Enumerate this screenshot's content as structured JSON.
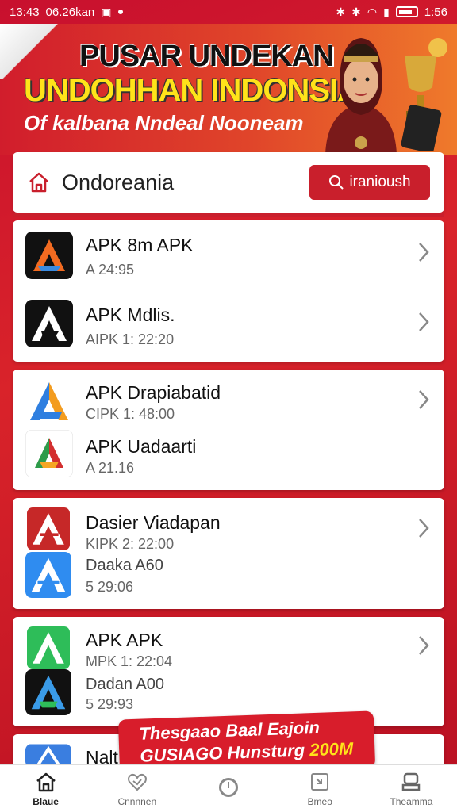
{
  "status_bar": {
    "time": "13:43",
    "carrier": "06.26kan",
    "clock_right": "1:56"
  },
  "banner": {
    "title1": "PUSAR UNDEKAN",
    "title2": "UNDOHHAN INDONSIA",
    "subtitle": "Of kalbana Nndeal Nooneam"
  },
  "search": {
    "title": "Ondoreania",
    "button_label": "iranioush",
    "icon": "home-icon"
  },
  "cards": [
    {
      "items": [
        {
          "title": "APK 8m APK",
          "sub": "A 24:95",
          "icon": "orange-a-icon"
        },
        {
          "title": "APK Mdlis.",
          "sub": "AIPK 1: 22:20",
          "icon": "black-a-icon"
        }
      ]
    },
    {
      "items": [
        {
          "title": "APK Drapiabatid",
          "sub": "CIPK 1: 48:00",
          "icon": "multicolor-a-icon"
        },
        {
          "title": "APK Uadaarti",
          "sub": "A 21.16",
          "icon": "tri-color-a-icon"
        }
      ]
    },
    {
      "items": [
        {
          "title": "Dasier Viadapan",
          "sub": "KIPK 2: 22:00",
          "icon": "red-a-icon"
        },
        {
          "title": "Daaka A60",
          "sub": "5 29:06",
          "icon": "blue-a-icon"
        }
      ]
    },
    {
      "items": [
        {
          "title": "APK APK",
          "sub": "MPK 1: 22:04",
          "icon": "green-a-icon"
        },
        {
          "title": "Dadan A00",
          "sub": "5 29:93",
          "icon": "dark-a-icon"
        }
      ]
    },
    {
      "items": [
        {
          "title": "Nalt",
          "sub": "",
          "icon": "blue-outline-icon"
        }
      ]
    }
  ],
  "promo": {
    "line1": "Thesgaao Baal Eajoin",
    "line2a": "GUSIAGO Hunsturg ",
    "line2b": "200M"
  },
  "bottom_nav": [
    {
      "label": "Blaue",
      "icon": "home-icon"
    },
    {
      "label": "Cnnnnen",
      "icon": "heart-icon"
    },
    {
      "label": "",
      "icon": "clock-icon"
    },
    {
      "label": "Bmeo",
      "icon": "download-icon"
    },
    {
      "label": "Theamma",
      "icon": "profile-icon"
    }
  ],
  "colors": {
    "brand_red": "#c91f2c",
    "accent_yellow": "#ffe31a"
  }
}
